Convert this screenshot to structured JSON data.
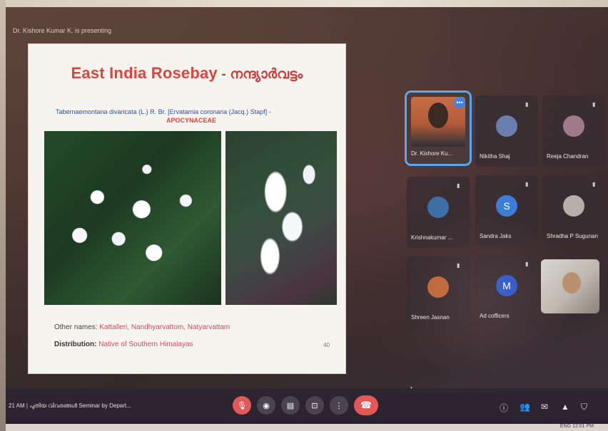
{
  "meeting": {
    "presenting_banner": "Dr. Kishore Kumar K. is presenting",
    "time_and_title": "21 AM  |  പുതിയ വിവരങ്ങൾ Seminar by Depart..."
  },
  "slide": {
    "title_en": "East India Rosebay",
    "title_sep": " - ",
    "title_ml": "നന്ദ്യാർവട്ടം",
    "scientific_name": "Tabernaemontana divaricata (L.) R. Br. [Ervatamia coronaria (Jacq.) Stapf] -",
    "family": "APOCYNACEAE",
    "other_names_label": "Other names:",
    "other_names_value": "Kattalleri, Nandhyarvattom, Natyarvattam",
    "distribution_label": "Distribution:",
    "distribution_value": "Native of Southern Himalayas",
    "slide_number": "40"
  },
  "participants": [
    {
      "name": "Dr. Kishore Ku...",
      "active": true
    },
    {
      "name": "Nikitha Shaj",
      "avatar_color": "#6a7fb0"
    },
    {
      "name": "Reeja Chandran",
      "avatar_color": "#a07a8a"
    },
    {
      "name": "Krishnakumar ...",
      "avatar_color": "#3d6ea8"
    },
    {
      "name": "Sandra Jaks",
      "avatar_color": "#3c7ed6",
      "initial": "S"
    },
    {
      "name": "Shradha P Sugunan",
      "avatar_color": "#b8b0a8"
    },
    {
      "name": "Shreen Jasnan",
      "avatar_color": "#c0663a"
    },
    {
      "name": "Ad cofficers",
      "avatar_color": "#2e58c8",
      "initial": "M"
    }
  ],
  "icons": {
    "mic": "🎙",
    "camera": "◉",
    "captions": "▤",
    "present": "⊡",
    "more": "⋮",
    "end_call": "☎",
    "info": "ⓘ",
    "people": "👥",
    "chat": "✉",
    "activities": "▲",
    "lock": "⛉",
    "speaking": "•••",
    "muted": "▮"
  },
  "taskbar_text": "ENG  12:01 PM"
}
